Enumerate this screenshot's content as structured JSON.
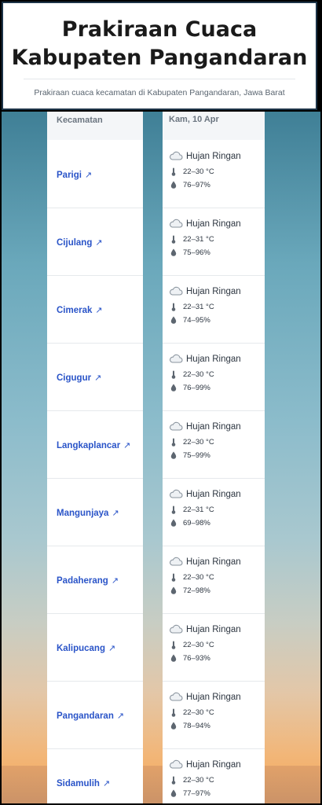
{
  "header": {
    "title": "Prakiraan Cuaca Kabupaten Pangandaran",
    "subtitle": "Prakiraan cuaca kecamatan di Kabupaten Pangandaran, Jawa Barat"
  },
  "table": {
    "column_name": "Kecamatan",
    "column_date": "Kam, 10 Apr",
    "rows": [
      {
        "name": "Parigi",
        "condition": "Hujan Ringan",
        "temp": "22–30 °C",
        "humidity": "76–97%"
      },
      {
        "name": "Cijulang",
        "condition": "Hujan Ringan",
        "temp": "22–31 °C",
        "humidity": "75–96%"
      },
      {
        "name": "Cimerak",
        "condition": "Hujan Ringan",
        "temp": "22–31 °C",
        "humidity": "74–95%"
      },
      {
        "name": "Cigugur",
        "condition": "Hujan Ringan",
        "temp": "22–30 °C",
        "humidity": "76–99%"
      },
      {
        "name": "Langkaplancar",
        "condition": "Hujan Ringan",
        "temp": "22–30 °C",
        "humidity": "75–99%"
      },
      {
        "name": "Mangunjaya",
        "condition": "Hujan Ringan",
        "temp": "22–31 °C",
        "humidity": "69–98%"
      },
      {
        "name": "Padaherang",
        "condition": "Hujan Ringan",
        "temp": "22–30 °C",
        "humidity": "72–98%"
      },
      {
        "name": "Kalipucang",
        "condition": "Hujan Ringan",
        "temp": "22–30 °C",
        "humidity": "76–93%"
      },
      {
        "name": "Pangandaran",
        "condition": "Hujan Ringan",
        "temp": "22–30 °C",
        "humidity": "78–94%"
      },
      {
        "name": "Sidamulih",
        "condition": "Hujan Ringan",
        "temp": "22–30 °C",
        "humidity": "77–97%"
      }
    ]
  },
  "icons": {
    "link": "external-link-icon",
    "weather": "cloud-rain-icon",
    "temperature": "thermometer-icon",
    "humidity": "droplet-icon"
  },
  "colors": {
    "link": "#2a54c8",
    "header_border": "#1d3448"
  }
}
